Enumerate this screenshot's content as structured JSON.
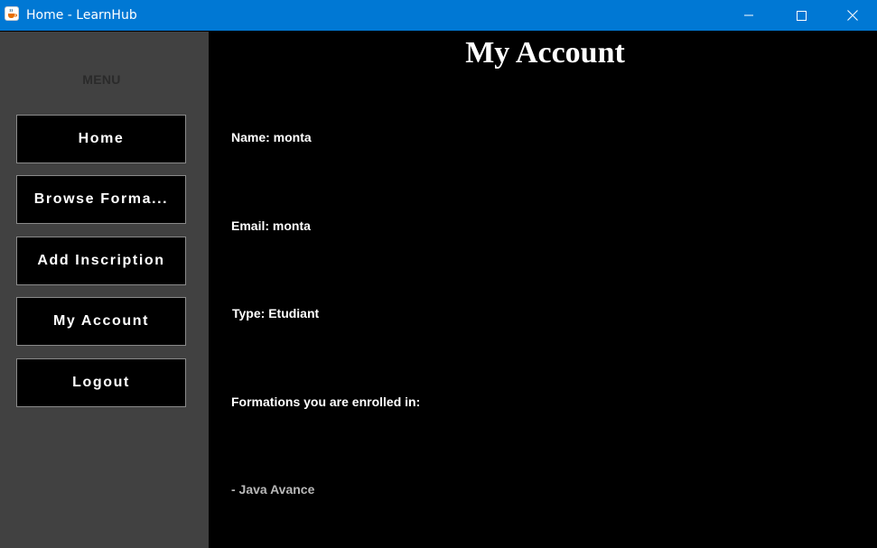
{
  "window": {
    "title": "Home - LearnHub",
    "icon": "java-cup-icon",
    "titlebar_color": "#0078d4",
    "controls": [
      "minimize",
      "maximize",
      "close"
    ]
  },
  "sidebar": {
    "menu_label": "MENU",
    "items": [
      {
        "label": "Home"
      },
      {
        "label": "Browse Forma..."
      },
      {
        "label": "Add Inscription"
      },
      {
        "label": "My Account"
      },
      {
        "label": "Logout"
      }
    ]
  },
  "main": {
    "title": "My Account",
    "name": "Name: monta",
    "email": "Email: monta",
    "type": "Type: Etudiant",
    "enrolled_heading": "Formations you are enrolled in:",
    "courses": [
      "- Java Avance"
    ]
  },
  "colors": {
    "sidebar_bg": "#414141",
    "main_bg": "#000000",
    "button_bg": "#000000",
    "text": "#ffffff"
  }
}
